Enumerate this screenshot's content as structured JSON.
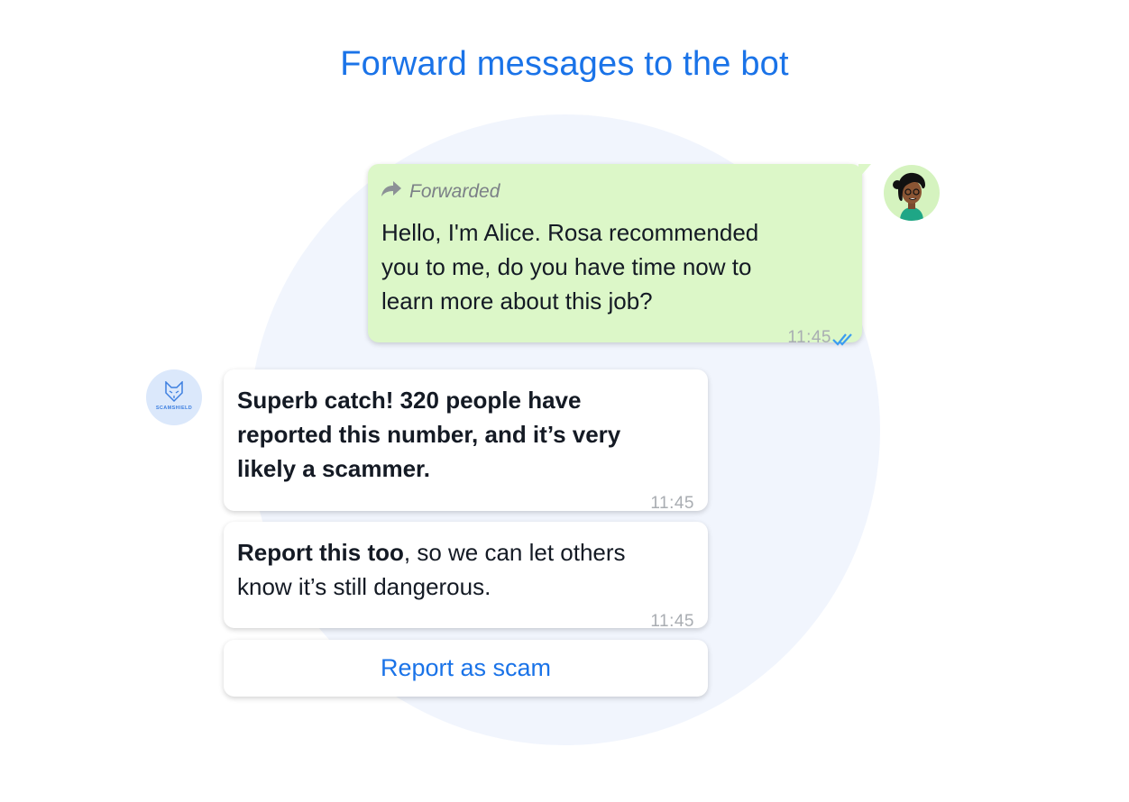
{
  "header": {
    "title": "Forward messages to the bot"
  },
  "messages": {
    "forwarded": {
      "label": "Forwarded",
      "lines": [
        "Hello, I'm Alice. Rosa recommended",
        "you to me, do you have time now to",
        "learn more about this job?"
      ],
      "time": "11:45"
    },
    "bot_reply_1": {
      "lines": [
        "Superb catch! 320 people have",
        "reported this number, and it’s very",
        "likely a scammer."
      ],
      "time": "11:45"
    },
    "bot_reply_2": {
      "bold": "Report this too",
      "rest_line1": ", so we can let others",
      "line2": "know it’s still dangerous.",
      "time": "11:45"
    }
  },
  "actions": {
    "report_button": "Report as scam"
  },
  "bot": {
    "logo_text": "SCAMSHIELD"
  },
  "colors": {
    "accent": "#1a73e8",
    "outgoing_bubble": "#dcf7c8",
    "read_ticks": "#3b9cf0",
    "background_circle": "#f1f5fd"
  },
  "icons": {
    "forward": "forward-arrow-icon",
    "read_receipt": "double-check-icon",
    "user_avatar": "woman-avatar",
    "bot_avatar": "fox-logo-icon"
  }
}
